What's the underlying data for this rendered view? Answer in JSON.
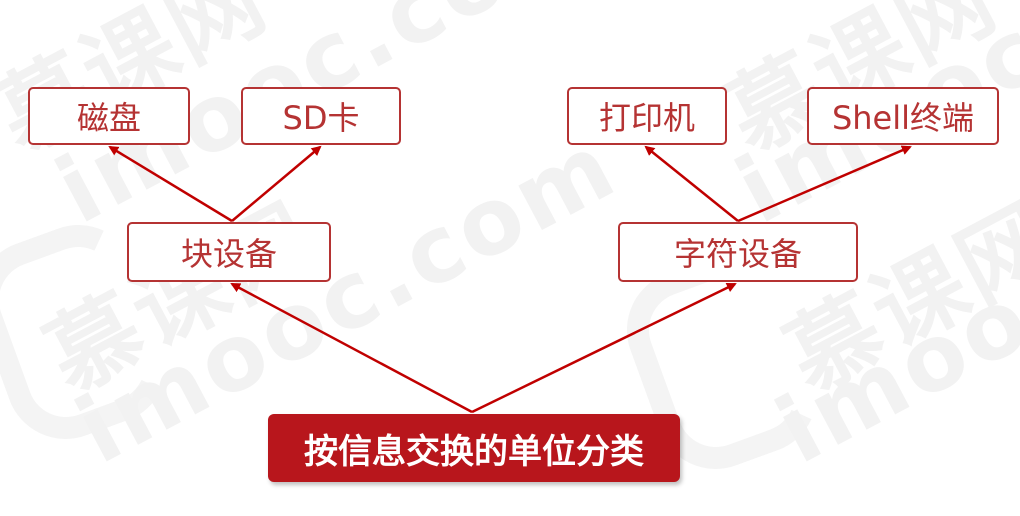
{
  "colors": {
    "accent": "#b8161c",
    "node_border": "#b53333",
    "node_text": "#b53333",
    "arrow": "#c00000",
    "watermark": "#f2f2f2"
  },
  "watermark": {
    "text": "imooc.com",
    "brand": "慕课网"
  },
  "diagram": {
    "root": {
      "label": "按信息交换的单位分类"
    },
    "block_device": {
      "label": "块设备",
      "children": [
        {
          "label": "磁盘"
        },
        {
          "label": "SD卡"
        }
      ]
    },
    "char_device": {
      "label": "字符设备",
      "children": [
        {
          "label": "打印机"
        },
        {
          "label": "Shell终端"
        }
      ]
    }
  }
}
